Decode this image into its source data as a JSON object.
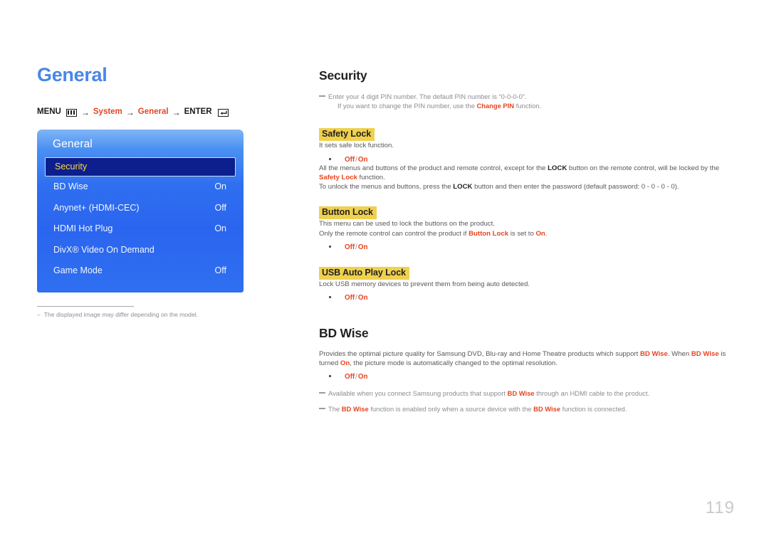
{
  "page": {
    "title": "General",
    "number": "119"
  },
  "breadcrumb": {
    "menu_label": "MENU",
    "menu_icon": "menu-grid-icon",
    "arrow": "→",
    "step1": "System",
    "step2": "General",
    "enter_label": "ENTER",
    "enter_icon": "enter-return-icon"
  },
  "osd": {
    "title": "General",
    "rows": [
      {
        "label": "Security",
        "value": "",
        "selected": true
      },
      {
        "label": "BD Wise",
        "value": "On",
        "selected": false
      },
      {
        "label": "Anynet+ (HDMI-CEC)",
        "value": "Off",
        "selected": false
      },
      {
        "label": "HDMI Hot Plug",
        "value": "On",
        "selected": false
      },
      {
        "label": "DivX® Video On Demand",
        "value": "",
        "selected": false
      },
      {
        "label": "Game Mode",
        "value": "Off",
        "selected": false
      }
    ]
  },
  "left_note": {
    "dash": "–",
    "text": "The displayed image may differ depending on the model."
  },
  "security": {
    "heading": "Security",
    "note_line1": "Enter your 4 digit PIN number. The default PIN number is “0-0-0-0”.",
    "note_line2_pre": "If you want to change the PIN number, use the ",
    "note_line2_hl": "Change PIN",
    "note_line2_post": " function."
  },
  "safety_lock": {
    "heading": "Safety Lock",
    "desc": "It sets safe lock function.",
    "options_off": "Off",
    "options_sep": "/",
    "options_on": "On",
    "para1_a": "All the menus and buttons of the product and remote control, except for the ",
    "para1_lock": "LOCK",
    "para1_b": " button on the remote control, will be locked by the ",
    "para1_safety": "Safety Lock",
    "para1_c": " function.",
    "para2_a": "To unlock the menus and buttons, press the ",
    "para2_lock": "LOCK",
    "para2_b": " button and then enter the password (default password: 0 - 0 - 0 - 0)."
  },
  "button_lock": {
    "heading": "Button Lock",
    "desc": "This menu can be used to lock the buttons on the product.",
    "para_a": "Only the remote control can control the product if ",
    "para_hl1": "Button Lock",
    "para_b": " is set to ",
    "para_hl2": "On",
    "para_c": ".",
    "options_off": "Off",
    "options_sep": "/",
    "options_on": "On"
  },
  "usb_auto_play_lock": {
    "heading": "USB Auto Play Lock",
    "desc": "Lock USB memory devices to prevent them from being auto detected.",
    "options_off": "Off",
    "options_sep": "/",
    "options_on": "On"
  },
  "bd_wise": {
    "heading": "BD Wise",
    "para_a": "Provides the optimal picture quality for Samsung DVD, Blu-ray and Home Theatre products which support ",
    "para_hl1": "BD Wise",
    "para_b": ". When ",
    "para_hl2": "BD Wise",
    "para_c": " is turned ",
    "para_hl3": "On",
    "para_d": ", the picture mode is automatically changed to the optimal resolution.",
    "options_off": "Off",
    "options_sep": "/",
    "options_on": "On",
    "note1_a": "Available when you connect Samsung products that support ",
    "note1_hl": "BD Wise",
    "note1_b": " through an HDMI cable to the product.",
    "note2_a": "The ",
    "note2_hl1": "BD Wise",
    "note2_b": " function is enabled only when a source device with the ",
    "note2_hl2": "BD Wise",
    "note2_c": " function is connected."
  },
  "colors": {
    "title_blue": "#4a86e8",
    "accent_red": "#e8441f",
    "highlight_yellow": "#efd14e",
    "osd_blue": "#2a65ef",
    "osd_selected_bg": "#0c1f8c",
    "osd_selected_text": "#ffd83b",
    "body_gray": "#58585a",
    "page_num_gray": "#c9c9ce"
  }
}
